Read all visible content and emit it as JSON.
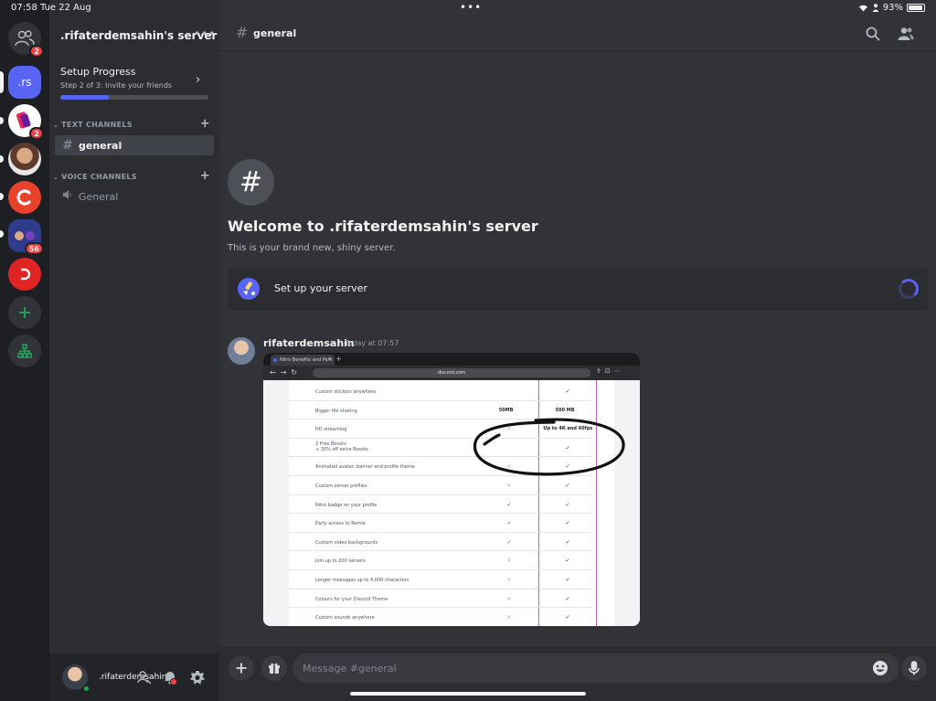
{
  "status_bar": {
    "time": "07:58",
    "date": "Tue 22 Aug",
    "battery": "93%"
  },
  "servers": [
    {
      "label": "",
      "badge": "2"
    },
    {
      "label": ".rs",
      "badge": ""
    },
    {
      "label": "",
      "badge": "2"
    },
    {
      "label": "",
      "badge": ""
    },
    {
      "label": "",
      "badge": ""
    },
    {
      "label": "",
      "badge": "56"
    },
    {
      "label": "",
      "badge": ""
    }
  ],
  "sidebar": {
    "server_name": ".rifaterdemsahin's server",
    "setup_progress": {
      "title": "Setup Progress",
      "subtitle": "Step 2 of 3: Invite your friends",
      "progress": 0.33
    },
    "text_category": "TEXT CHANNELS",
    "voice_category": "VOICE CHANNELS",
    "text_channels": [
      {
        "name": "general"
      }
    ],
    "voice_channels": [
      {
        "name": "General"
      }
    ]
  },
  "user": {
    "name": ".rifaterdemsahin"
  },
  "header": {
    "channel_name": "general"
  },
  "welcome": {
    "title": "Welcome to .rifaterdemsahin's server",
    "subtitle": "This is your brand new, shiny server.",
    "setup_label": "Set up your server"
  },
  "message": {
    "author": "rifaterdemsahin",
    "timestamp": "Today at 07:57",
    "attachment": {
      "tab_title": "Nitro Benefits and Perk",
      "url": "discord.com",
      "rows": [
        {
          "feature": "Custom stickers anywhere",
          "basic": "",
          "nitro": "✓"
        },
        {
          "feature": "Bigger file sharing",
          "basic": "50MB",
          "nitro": "500 MB"
        },
        {
          "feature": "HD streaming",
          "basic": "✕",
          "nitro": "Up to 4K and 60fps"
        },
        {
          "feature": "2 Free Boosts\n+ 30% off extra Boosts",
          "basic": "",
          "nitro": "✓"
        },
        {
          "feature": "Animated avatar, banner and profile theme",
          "basic": "✕",
          "nitro": "✓"
        },
        {
          "feature": "Custom server profiles",
          "basic": "✕",
          "nitro": "✓"
        },
        {
          "feature": "Nitro badge on your profile",
          "basic": "✓",
          "nitro": "✓"
        },
        {
          "feature": "Early access to Remix",
          "basic": "✓",
          "nitro": "✓"
        },
        {
          "feature": "Custom video backgrounds",
          "basic": "✓",
          "nitro": "✓"
        },
        {
          "feature": "Join up to 200 servers",
          "basic": "✕",
          "nitro": "✓"
        },
        {
          "feature": "Longer messages up to 4,000 characters",
          "basic": "✕",
          "nitro": "✓"
        },
        {
          "feature": "Colours for your Discord Theme",
          "basic": "✕",
          "nitro": "✓"
        },
        {
          "feature": "Custom sounds anywhere",
          "basic": "✕",
          "nitro": "✓"
        }
      ]
    }
  },
  "composer": {
    "placeholder": "Message #general"
  },
  "colors": {
    "accent": "#5865f2",
    "online": "#23a55a",
    "badge": "#f23f43"
  }
}
